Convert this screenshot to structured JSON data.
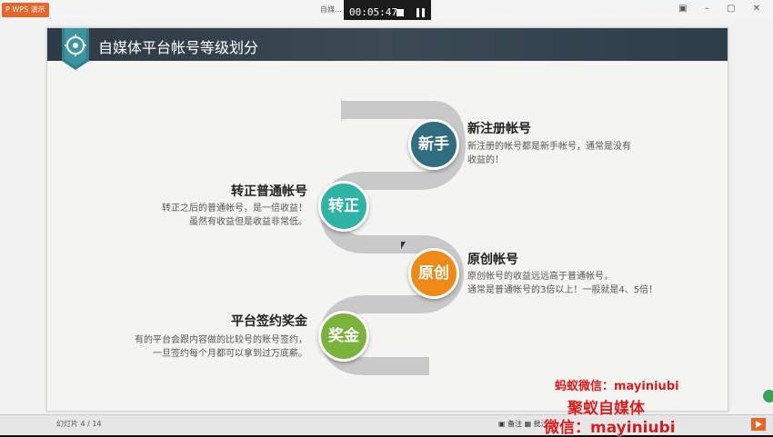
{
  "window": {
    "app_logo": "P WPS 演示",
    "doc_tab": "自媒…",
    "timer": "00:05:47"
  },
  "slide": {
    "title": "自媒体平台帐号等级划分",
    "levels": [
      {
        "badge": "新手",
        "heading": "新注册帐号",
        "desc_lines": [
          "新注册的帐号都是新手帐号，通常是没有",
          "收益的！"
        ],
        "color": "#2e6e7f"
      },
      {
        "badge": "转正",
        "heading": "转正普通帐号",
        "desc_lines": [
          "转正之后的普通帐号，是一倍收益！",
          "虽然有收益但是收益非常低。"
        ],
        "color": "#2fb3a5"
      },
      {
        "badge": "原创",
        "heading": "原创帐号",
        "desc_lines": [
          "原创帐号的收益远远高于普通帐号，",
          "通常是普通帐号的3倍以上！一般就是4、5倍！"
        ],
        "color": "#f08a16"
      },
      {
        "badge": "奖金",
        "heading": "平台签约奖金",
        "desc_lines": [
          "有的平台会跟内容做的比较号的账号签约，",
          "一旦签约每个月都可以拿到过万底薪。"
        ],
        "color": "#7ab33b"
      }
    ]
  },
  "taskbar": {
    "slide_counter": "幻灯片 4 / 14",
    "icons_text": "▣ 备注 ▦ 批注"
  },
  "watermarks": {
    "line1": "蚂蚁微信：mayiniubi",
    "line2": "聚蚁自媒体",
    "line3": "微信：mayiniubi"
  }
}
